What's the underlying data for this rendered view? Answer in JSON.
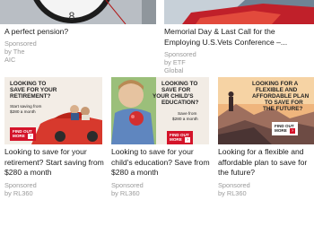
{
  "top_cards": [
    {
      "title": "A perfect pension?",
      "sponsor": "Sponsored by The AIC",
      "image": "clock-face-photo"
    },
    {
      "title": "Memorial Day & Last Call for the Employing U.S.Vets Conference –...",
      "sponsor": "Sponsored by ETF Global",
      "image": "car-photo"
    }
  ],
  "ad_cards": [
    {
      "headline_1": "LOOKING TO",
      "headline_2": "SAVE FOR YOUR",
      "headline_3": "RETIREMENT?",
      "sub_1": "Start saving from",
      "sub_2": "$280 a month",
      "cta_1": "FIND OUT",
      "cta_2": "MORE",
      "title": "Looking to save for your retirement? Start saving from $280 a month",
      "sponsor": "Sponsored by RL360",
      "image": "red-car-couple-photo"
    },
    {
      "headline_1": "LOOKING TO",
      "headline_2": "SAVE FOR",
      "headline_3": "YOUR CHILD'S",
      "headline_4": "EDUCATION?",
      "sub_1": "Save from",
      "sub_2": "$280 a month",
      "cta_1": "FIND OUT",
      "cta_2": "MORE",
      "title": "Looking to save for your child's education? Save from $280 a month",
      "sponsor": "Sponsored by RL360",
      "image": "child-with-apple-photo"
    },
    {
      "headline_1": "LOOKING FOR A",
      "headline_2": "FLEXIBLE AND",
      "headline_3": "AFFORDABLE PLAN",
      "headline_4": "TO SAVE FOR",
      "headline_5": "THE FUTURE?",
      "cta_1": "FIND OUT",
      "cta_2": "MORE",
      "title": "Looking for a flexible and affordable plan to save for the future?",
      "sponsor": "Sponsored by RL360",
      "image": "mountain-hiker-photo"
    }
  ],
  "colors": {
    "accent_red": "#d4142a",
    "sponsor_grey": "#9a9a9a"
  }
}
